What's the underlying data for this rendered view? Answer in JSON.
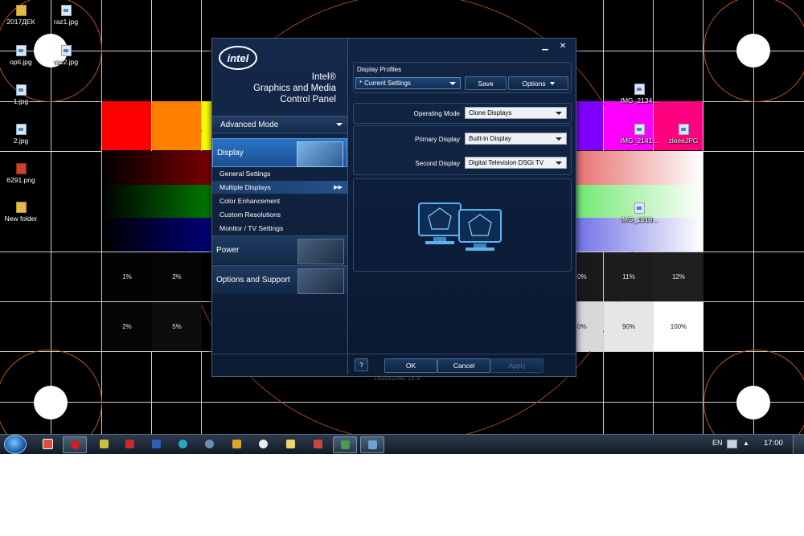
{
  "desktop": {
    "icons": [
      {
        "label": "2017ДЕК",
        "type": "folder"
      },
      {
        "label": "raz1.jpg",
        "type": "image"
      },
      {
        "label": "opti.jpg",
        "type": "image"
      },
      {
        "label": "raz2.jpg",
        "type": "image"
      },
      {
        "label": "1.jpg",
        "type": "image"
      },
      {
        "label": "2.jpg",
        "type": "image"
      },
      {
        "label": "6291.png",
        "type": "png"
      },
      {
        "label": "New folder",
        "type": "folder"
      },
      {
        "label": "IMG_2134...",
        "type": "image"
      },
      {
        "label": "IMG_2141...",
        "type": "image"
      },
      {
        "label": "zleeeJPG",
        "type": "image"
      },
      {
        "label": "IMG_1919...",
        "type": "image"
      }
    ],
    "test_pattern": {
      "swatch_colors": [
        "#ff0000",
        "#ff7f00",
        "#ffff00",
        "#8000ff",
        "#ff00ff",
        "#ff0080"
      ],
      "percent_row1": [
        "1%",
        "2%",
        "0%",
        "11%",
        "12%"
      ],
      "percent_row2": [
        "2%",
        "5%",
        "0%",
        "90%",
        "100%"
      ],
      "resolution_text": "1920x1080   16:9"
    }
  },
  "dialog": {
    "logo": "intel",
    "title_line1": "Intel®",
    "title_line2": "Graphics and Media",
    "title_line3": "Control Panel",
    "mode_label": "Advanced Mode",
    "nav": {
      "display": "Display",
      "power": "Power",
      "options_support": "Options and Support"
    },
    "display_subitems": [
      "General Settings",
      "Multiple Displays",
      "Color Enhancement",
      "Custom Resolutions",
      "Monitor / TV Settings"
    ],
    "profiles": {
      "heading": "Display Profiles",
      "current": "Current Settings",
      "save": "Save",
      "options": "Options"
    },
    "operating_mode": {
      "label": "Operating Mode",
      "value": "Clone Displays"
    },
    "primary_display": {
      "label": "Primary Display",
      "value": "Built-in Display"
    },
    "second_display": {
      "label": "Second Display",
      "value": "Digital Television DSGi TV"
    },
    "buttons": {
      "help": "?",
      "ok": "OK",
      "cancel": "Cancel",
      "apply": "Apply"
    }
  },
  "taskbar": {
    "language": "EN",
    "clock": "17:00"
  }
}
